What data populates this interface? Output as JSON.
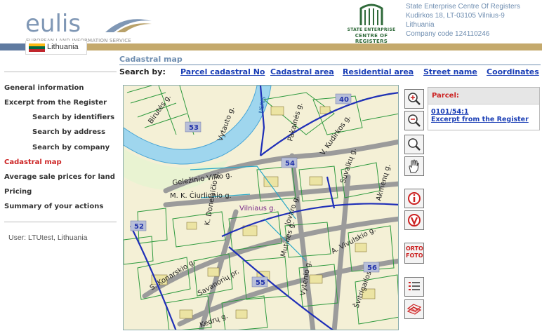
{
  "header": {
    "logo_text": "eulis",
    "logo_subtitle": "EUROPEAN LAND INFORMATION SERVICE",
    "country": "Lithuania",
    "org_logo_line1": "STATE ENTERPRISE",
    "org_logo_line2": "CENTRE OF REGISTERS",
    "org_info": [
      "State Enterprise Centre Of Registers",
      "Kudirkos 18, LT-03105 Vilnius-9",
      "Lithuania",
      "Company code 124110246"
    ]
  },
  "page_title": "Cadastral map",
  "search": {
    "label": "Search by:",
    "links": [
      "Parcel cadastral No",
      "Cadastral area",
      "Residential area",
      "Street name",
      "Coordinates"
    ]
  },
  "sidebar": {
    "items": [
      {
        "label": "General information"
      },
      {
        "label": "Excerpt from the Register"
      },
      {
        "label": "Search by identifiers"
      },
      {
        "label": "Search by address"
      },
      {
        "label": "Search by company"
      },
      {
        "label": "Cadastral map"
      },
      {
        "label": "Average sale prices for land"
      },
      {
        "label": "Pricing"
      },
      {
        "label": "Summary of your actions"
      }
    ],
    "user": "User: LTUtest, Lithuania"
  },
  "map": {
    "street_labels": [
      "Birutės g.",
      "Vytauto g.",
      "NERIS",
      "Pakalnės g.",
      "V. Kudirkos g.",
      "Geležinio Vilko g.",
      "Suvalkų g.",
      "Akmenų g.",
      "M. K. Čiurlionio g.",
      "Vilniaus g.",
      "Jovaro g.",
      "K. Donelaičio g.",
      "Mutinės g.",
      "A. Vivulskio g.",
      "S. Konarskio g.",
      "Savanorių pr.",
      "Vytenio g.",
      "Švitrigailos g.",
      "Kedrų g."
    ],
    "area_numbers": [
      "40",
      "53",
      "54",
      "52",
      "56",
      "55"
    ]
  },
  "tools": {
    "zoom_in": "zoom-in-icon",
    "zoom_out": "zoom-out-icon",
    "zoom_area": "magnifier-icon",
    "pan": "hand-icon",
    "info": "info-icon",
    "select": "select-icon",
    "ortho_label_1": "ORTO",
    "ortho_label_2": "FOTO",
    "legend": "legend-icon",
    "layers": "layers-icon"
  },
  "parcel": {
    "heading": "Parcel:",
    "number": "0101/54:1",
    "excerpt_link": "Excerpt from the Register"
  },
  "colors": {
    "accent_blue": "#1a3eb5",
    "active_red": "#cc2222",
    "band_gold": "#c4a96c",
    "parcel_green": "#2e9a3e",
    "river_blue": "#9fd6ee"
  }
}
